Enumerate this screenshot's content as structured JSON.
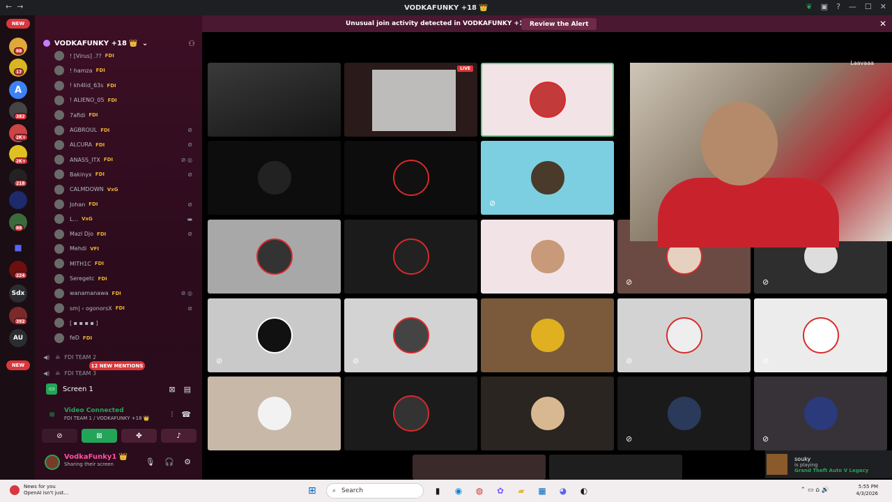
{
  "window": {
    "title": "VODKAFUNKY +18 👑",
    "nav_back": "←",
    "nav_fwd": "→"
  },
  "rail": {
    "new_top": "NEW",
    "new_bottom": "NEW",
    "badges": [
      "88",
      "17",
      "382",
      "2K+",
      "2K+",
      "218",
      "88",
      "224",
      "392"
    ],
    "labels": {
      "sdx": "Sdx",
      "au": "AU"
    }
  },
  "server": {
    "name": "VODKAFUNKY +18 👑"
  },
  "members": [
    {
      "name": "! [Virus] .??",
      "tag": "FDI",
      "mic": ""
    },
    {
      "name": "! hamza",
      "tag": "FDI",
      "mic": ""
    },
    {
      "name": "! kh4lid_63s",
      "tag": "FDI",
      "mic": ""
    },
    {
      "name": "! ALIENO_05",
      "tag": "FDI",
      "mic": ""
    },
    {
      "name": "7afidi",
      "tag": "FDI",
      "mic": ""
    },
    {
      "name": "AGBROUL",
      "tag": "FDI",
      "mic": "⊘"
    },
    {
      "name": "ALCURA",
      "tag": "FDI",
      "mic": "⊘"
    },
    {
      "name": "ANASS_ITX",
      "tag": "FDI",
      "mic": "⊘ ◎"
    },
    {
      "name": "Bakinyx",
      "tag": "FDI",
      "mic": "⊘"
    },
    {
      "name": "CALMDOWN",
      "tag": "VxG",
      "mic": ""
    },
    {
      "name": "Johan",
      "tag": "FDI",
      "mic": "⊘"
    },
    {
      "name": "L...",
      "tag": "VxG",
      "mic": "▬"
    },
    {
      "name": "Mazl Djo",
      "tag": "FDI",
      "mic": "⊘"
    },
    {
      "name": "Mehdi",
      "tag": "VFI",
      "mic": ""
    },
    {
      "name": "MITH1C",
      "tag": "FDI",
      "mic": ""
    },
    {
      "name": "Seregetc",
      "tag": "FDI",
      "mic": ""
    },
    {
      "name": "wanamanawa",
      "tag": "FDI",
      "mic": "⊘ ◎"
    },
    {
      "name": "sm| ‹ ogonorsX",
      "tag": "FDI",
      "mic": "⊘"
    },
    {
      "name": "[ ▪ ▪ ▪ ▪ ]",
      "tag": "",
      "mic": ""
    },
    {
      "name": "feD",
      "tag": "FDI",
      "mic": ""
    }
  ],
  "voice_channels": [
    "FDI TEAM 2",
    "FDI TEAM 3"
  ],
  "mentions_pill": "12 NEW MENTIONS",
  "screen_panel": {
    "label": "Screen 1"
  },
  "voice_status": {
    "status": "Video Connected",
    "channel": "FDI TEAM 1 / VODKAFUNKY +18 👑"
  },
  "user": {
    "name": "VodkaFunky1 👑",
    "status": "Sharing their screen"
  },
  "alert": {
    "message": "Unusual join activity detected in VODKAFUNKY +18 👑",
    "button": "Review the Alert"
  },
  "stage": {
    "live_badge": "LIVE",
    "cam_label": "Laavaaa"
  },
  "activity": {
    "name": "souky",
    "status": "is playing",
    "game": "Grand Theft Auto V Legacy"
  },
  "taskbar": {
    "news_title": "News for you",
    "news_sub": "OpenAI isn't just...",
    "search": "Search",
    "time": "5:55 PM",
    "date": "4/3/2026"
  },
  "colors": {
    "accent_green": "#23a559",
    "alert_red": "#da373c",
    "sidebar_bg": "#3d0f25"
  }
}
